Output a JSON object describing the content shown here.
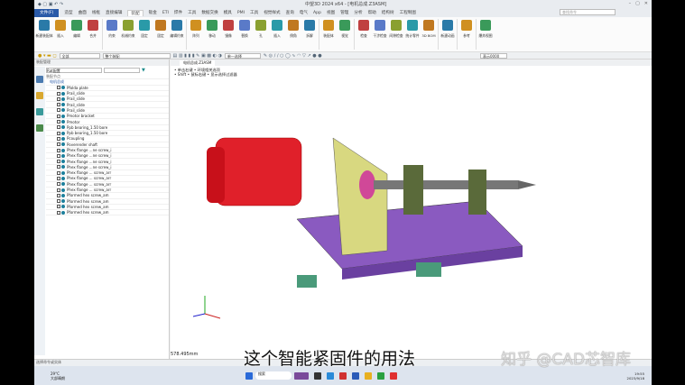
{
  "title": "中望3D 2024 x64 - [电机总成.Z3ASM]",
  "tabs": [
    "文件(F)",
    "造型",
    "曲面",
    "线框",
    "直接编辑",
    "装配",
    "钣金",
    "ETI",
    "焊件",
    "工具",
    "数据交换",
    "模具",
    "PMI",
    "工具",
    "视觉样式",
    "查询",
    "电气",
    "App",
    "视图",
    "管理",
    "分析",
    "帮助",
    "结构树",
    "工程制图"
  ],
  "active_tab": "装配",
  "search_placeholder": "查找命令",
  "ribbon": [
    "新建装配体",
    "插入",
    "编辑",
    "合并",
    "约束",
    "机械约束",
    "固定",
    "固定",
    "编辑约束",
    "阵列",
    "移动",
    "镜像",
    "替换",
    "孔",
    "插入",
    "倒角",
    "拆解",
    "装配体",
    "视觉",
    "检查",
    "干涉检查",
    "间隙检查",
    "统计零件",
    "3D BOM",
    "新建动画",
    "参考",
    "爆炸视图"
  ],
  "toolbar": {
    "filter": "全部",
    "assembly": "整个装配",
    "select": "单一选择",
    "zoom": "表示0000"
  },
  "panel": {
    "title": "装配管理",
    "filter_input": "Rat配置",
    "column": "装配节点",
    "root": "电机总成"
  },
  "tree": [
    "Pfolda plate",
    "Prail_slide",
    "Prail_slide",
    "Prail_slide",
    "Prail_slide",
    "Pmotor bracket",
    "Pmotor",
    "Ppb bearing_1.50 bore",
    "Ppb bearing_1.50 bore",
    "Pcoupling",
    "Poverender shaft",
    "Phex flange ...ne screw_i",
    "Phex flange ...ne screw_i",
    "Phex flange ...ne screw_i",
    "Phex flange ...ne screw_i",
    "Phex flange ... screw_arr",
    "Phex flange ... screw_arr",
    "Phex flange ... screw_arr",
    "Phex flange ... screw_arr",
    "Pformed hex screw_am",
    "Pformed hex screw_am",
    "Pformed hex screw_am",
    "Pformed hex screw_am"
  ],
  "view": {
    "tab": "电机总成.Z3ASM",
    "hint1": "• 单击右键 • 环境相关选项",
    "hint2": "• Shift • 鼠标右键 • 显示选择过滤器",
    "measure": "578.495mm"
  },
  "status": "选择命令或实体",
  "subtitle": "这个智能紧固件的用法",
  "watermark": "知乎 @CAD芯智库",
  "taskbar": {
    "weather": "29°C",
    "weather_desc": "大部晴朗",
    "search": "搜索",
    "time": "19:55",
    "date": "2023/9/18"
  }
}
